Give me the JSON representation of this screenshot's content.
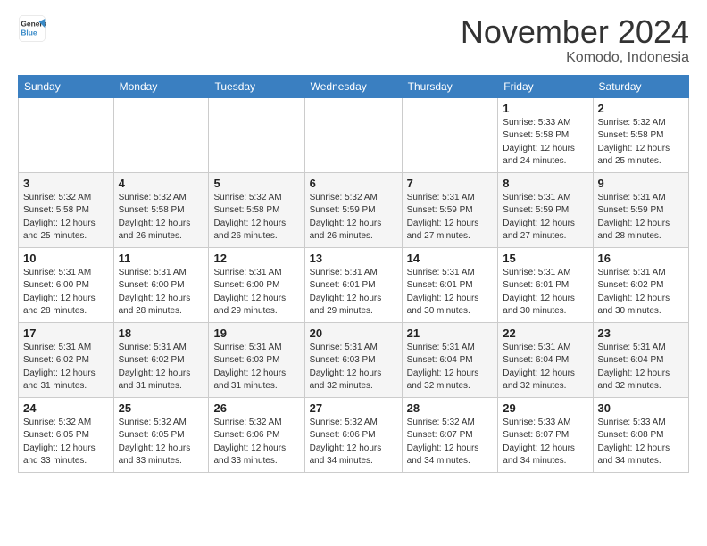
{
  "header": {
    "logo_line1": "General",
    "logo_line2": "Blue",
    "month_title": "November 2024",
    "location": "Komodo, Indonesia"
  },
  "calendar": {
    "days_of_week": [
      "Sunday",
      "Monday",
      "Tuesday",
      "Wednesday",
      "Thursday",
      "Friday",
      "Saturday"
    ],
    "weeks": [
      [
        {
          "day": "",
          "info": ""
        },
        {
          "day": "",
          "info": ""
        },
        {
          "day": "",
          "info": ""
        },
        {
          "day": "",
          "info": ""
        },
        {
          "day": "",
          "info": ""
        },
        {
          "day": "1",
          "info": "Sunrise: 5:33 AM\nSunset: 5:58 PM\nDaylight: 12 hours\nand 24 minutes."
        },
        {
          "day": "2",
          "info": "Sunrise: 5:32 AM\nSunset: 5:58 PM\nDaylight: 12 hours\nand 25 minutes."
        }
      ],
      [
        {
          "day": "3",
          "info": "Sunrise: 5:32 AM\nSunset: 5:58 PM\nDaylight: 12 hours\nand 25 minutes."
        },
        {
          "day": "4",
          "info": "Sunrise: 5:32 AM\nSunset: 5:58 PM\nDaylight: 12 hours\nand 26 minutes."
        },
        {
          "day": "5",
          "info": "Sunrise: 5:32 AM\nSunset: 5:58 PM\nDaylight: 12 hours\nand 26 minutes."
        },
        {
          "day": "6",
          "info": "Sunrise: 5:32 AM\nSunset: 5:59 PM\nDaylight: 12 hours\nand 26 minutes."
        },
        {
          "day": "7",
          "info": "Sunrise: 5:31 AM\nSunset: 5:59 PM\nDaylight: 12 hours\nand 27 minutes."
        },
        {
          "day": "8",
          "info": "Sunrise: 5:31 AM\nSunset: 5:59 PM\nDaylight: 12 hours\nand 27 minutes."
        },
        {
          "day": "9",
          "info": "Sunrise: 5:31 AM\nSunset: 5:59 PM\nDaylight: 12 hours\nand 28 minutes."
        }
      ],
      [
        {
          "day": "10",
          "info": "Sunrise: 5:31 AM\nSunset: 6:00 PM\nDaylight: 12 hours\nand 28 minutes."
        },
        {
          "day": "11",
          "info": "Sunrise: 5:31 AM\nSunset: 6:00 PM\nDaylight: 12 hours\nand 28 minutes."
        },
        {
          "day": "12",
          "info": "Sunrise: 5:31 AM\nSunset: 6:00 PM\nDaylight: 12 hours\nand 29 minutes."
        },
        {
          "day": "13",
          "info": "Sunrise: 5:31 AM\nSunset: 6:01 PM\nDaylight: 12 hours\nand 29 minutes."
        },
        {
          "day": "14",
          "info": "Sunrise: 5:31 AM\nSunset: 6:01 PM\nDaylight: 12 hours\nand 30 minutes."
        },
        {
          "day": "15",
          "info": "Sunrise: 5:31 AM\nSunset: 6:01 PM\nDaylight: 12 hours\nand 30 minutes."
        },
        {
          "day": "16",
          "info": "Sunrise: 5:31 AM\nSunset: 6:02 PM\nDaylight: 12 hours\nand 30 minutes."
        }
      ],
      [
        {
          "day": "17",
          "info": "Sunrise: 5:31 AM\nSunset: 6:02 PM\nDaylight: 12 hours\nand 31 minutes."
        },
        {
          "day": "18",
          "info": "Sunrise: 5:31 AM\nSunset: 6:02 PM\nDaylight: 12 hours\nand 31 minutes."
        },
        {
          "day": "19",
          "info": "Sunrise: 5:31 AM\nSunset: 6:03 PM\nDaylight: 12 hours\nand 31 minutes."
        },
        {
          "day": "20",
          "info": "Sunrise: 5:31 AM\nSunset: 6:03 PM\nDaylight: 12 hours\nand 32 minutes."
        },
        {
          "day": "21",
          "info": "Sunrise: 5:31 AM\nSunset: 6:04 PM\nDaylight: 12 hours\nand 32 minutes."
        },
        {
          "day": "22",
          "info": "Sunrise: 5:31 AM\nSunset: 6:04 PM\nDaylight: 12 hours\nand 32 minutes."
        },
        {
          "day": "23",
          "info": "Sunrise: 5:31 AM\nSunset: 6:04 PM\nDaylight: 12 hours\nand 32 minutes."
        }
      ],
      [
        {
          "day": "24",
          "info": "Sunrise: 5:32 AM\nSunset: 6:05 PM\nDaylight: 12 hours\nand 33 minutes."
        },
        {
          "day": "25",
          "info": "Sunrise: 5:32 AM\nSunset: 6:05 PM\nDaylight: 12 hours\nand 33 minutes."
        },
        {
          "day": "26",
          "info": "Sunrise: 5:32 AM\nSunset: 6:06 PM\nDaylight: 12 hours\nand 33 minutes."
        },
        {
          "day": "27",
          "info": "Sunrise: 5:32 AM\nSunset: 6:06 PM\nDaylight: 12 hours\nand 34 minutes."
        },
        {
          "day": "28",
          "info": "Sunrise: 5:32 AM\nSunset: 6:07 PM\nDaylight: 12 hours\nand 34 minutes."
        },
        {
          "day": "29",
          "info": "Sunrise: 5:33 AM\nSunset: 6:07 PM\nDaylight: 12 hours\nand 34 minutes."
        },
        {
          "day": "30",
          "info": "Sunrise: 5:33 AM\nSunset: 6:08 PM\nDaylight: 12 hours\nand 34 minutes."
        }
      ]
    ]
  }
}
